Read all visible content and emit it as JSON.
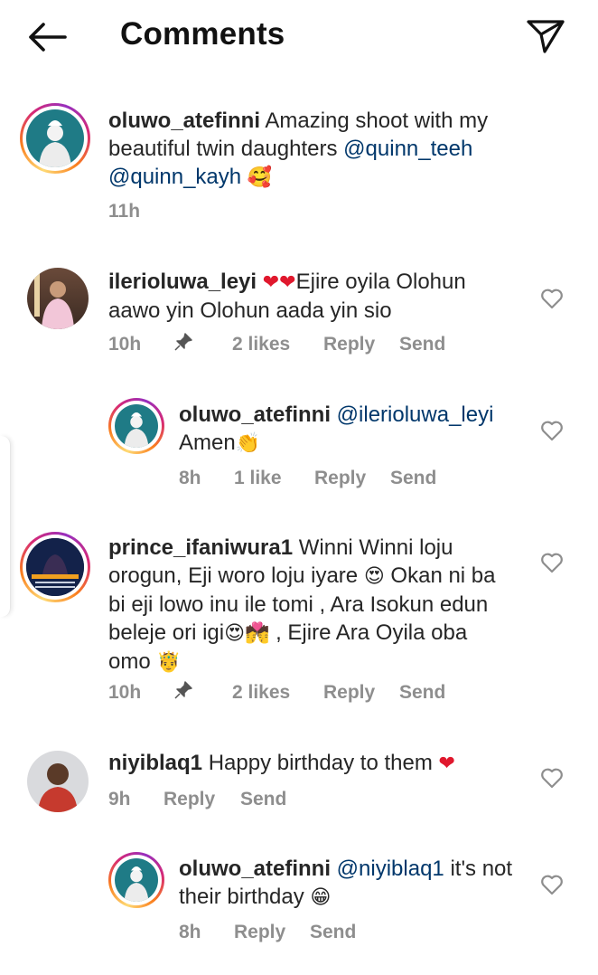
{
  "header": {
    "title": "Comments",
    "back_icon": "arrow-left-icon",
    "share_icon": "paper-plane-icon"
  },
  "caption": {
    "username": "oluwo_atefinni",
    "text": "Amazing shoot with my beautiful twin daughters",
    "mentions": "@quinn_teeh @quinn_kayh",
    "emoji": "🥰",
    "time": "11h"
  },
  "comments": [
    {
      "username": "ilerioluwa_leyi",
      "emoji_prefix": "❤❤",
      "text": "Ejire oyila Olohun aawo yin Olohun aada yin sio",
      "time": "10h",
      "pin_icon": "pin-icon",
      "likes": "2 likes",
      "reply": "Reply",
      "send": "Send"
    },
    {
      "username": "oluwo_atefinni",
      "mention": "@ilerioluwa_leyi",
      "text": "Amen",
      "emoji": "👏",
      "time": "8h",
      "likes": "1 like",
      "reply": "Reply",
      "send": "Send"
    },
    {
      "username": "prince_ifaniwura1",
      "text_a": "Winni Winni loju orogun, Eji woro loju iyare",
      "emoji_a": "😍",
      "text_b": "Okan ni ba bi eji lowo inu ile tomi , Ara Isokun edun beleje ori igi",
      "emoji_b": "😍💏",
      "text_c": ", Ejire Ara Oyila oba omo",
      "emoji_c": "🤴",
      "time": "10h",
      "likes": "2 likes",
      "reply": "Reply",
      "send": "Send"
    },
    {
      "username": "niyiblaq1",
      "text": "Happy birthday to them",
      "emoji": "❤",
      "time": "9h",
      "reply": "Reply",
      "send": "Send"
    },
    {
      "username": "oluwo_atefinni",
      "mention": "@niyiblaq1",
      "text": "it's not their birthday",
      "emoji": "😁",
      "time": "8h",
      "reply": "Reply",
      "send": "Send"
    }
  ],
  "colors": {
    "text": "#262626",
    "meta": "#8e8e8e",
    "mention": "#00376b",
    "heart_red": "#e0182d",
    "avatar_teal": "#1f7b86"
  }
}
